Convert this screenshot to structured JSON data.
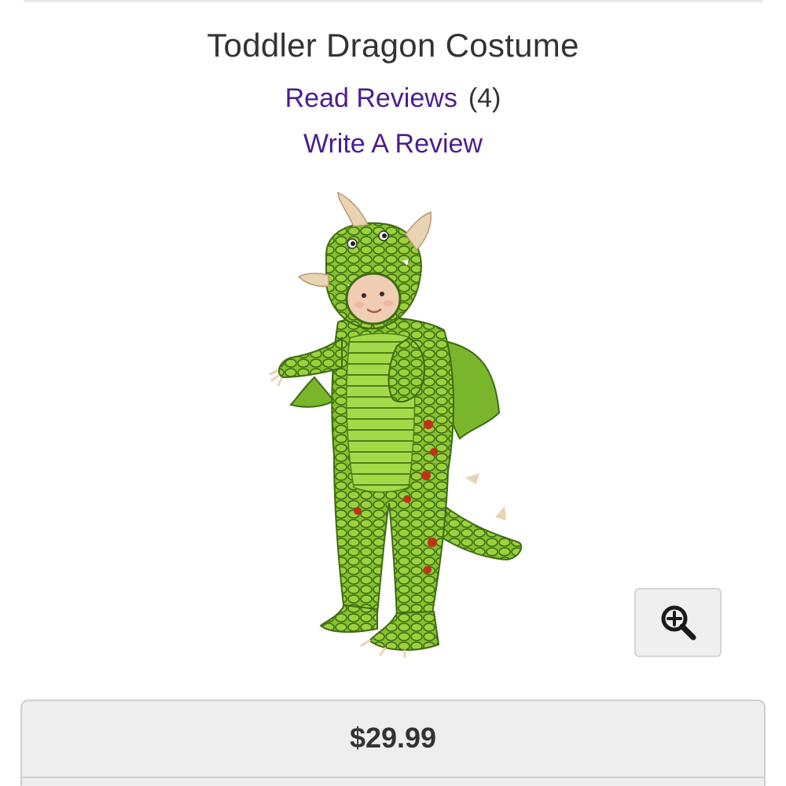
{
  "product": {
    "title": "Toddler Dragon Costume",
    "read_reviews_label": "Read Reviews",
    "review_count": "(4)",
    "write_review_label": "Write A Review",
    "image_alt": "Toddler in green dragon costume",
    "price": "$29.99"
  },
  "icons": {
    "zoom": "zoom-in-icon"
  },
  "colors": {
    "link": "#4b1d8f",
    "text": "#333333",
    "costume_green": "#7fb82b",
    "costume_dark": "#3f6b14",
    "horn": "#e8d3b4",
    "spot_red": "#c0321c"
  }
}
